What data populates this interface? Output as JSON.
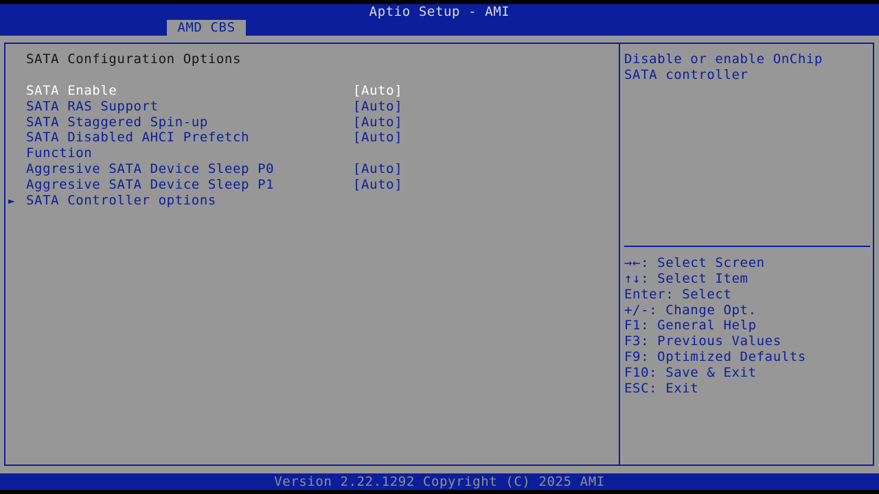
{
  "header": {
    "title": "Aptio Setup - AMI",
    "tab": "AMD CBS"
  },
  "main": {
    "section_title": "SATA Configuration Options",
    "items": [
      {
        "label": "SATA Enable",
        "value": "[Auto]",
        "selected": true
      },
      {
        "label": "SATA RAS Support",
        "value": "[Auto]"
      },
      {
        "label": "SATA Staggered Spin-up",
        "value": "[Auto]"
      },
      {
        "label": "SATA Disabled AHCI Prefetch",
        "label_line2": "Function",
        "value": "[Auto]"
      },
      {
        "label": "Aggresive SATA Device Sleep P0",
        "value": "[Auto]"
      },
      {
        "label": "Aggresive SATA Device Sleep P1",
        "value": "[Auto]"
      },
      {
        "label": "SATA Controller options",
        "submenu_marker": "►"
      }
    ]
  },
  "help": {
    "line1": "Disable or enable OnChip",
    "line2": "SATA controller"
  },
  "keys": [
    "→←: Select Screen",
    "↑↓: Select Item",
    "Enter: Select",
    "+/-: Change Opt.",
    "F1: General Help",
    "F3: Previous Values",
    "F9: Optimized Defaults",
    "F10: Save & Exit",
    "ESC: Exit"
  ],
  "footer": {
    "version": "Version 2.22.1292 Copyright (C) 2025 AMI"
  },
  "colors": {
    "frame_blue": "#0c1f9a",
    "panel_gray": "#979797",
    "selected_text": "#ffffff",
    "static_text": "#161616"
  }
}
